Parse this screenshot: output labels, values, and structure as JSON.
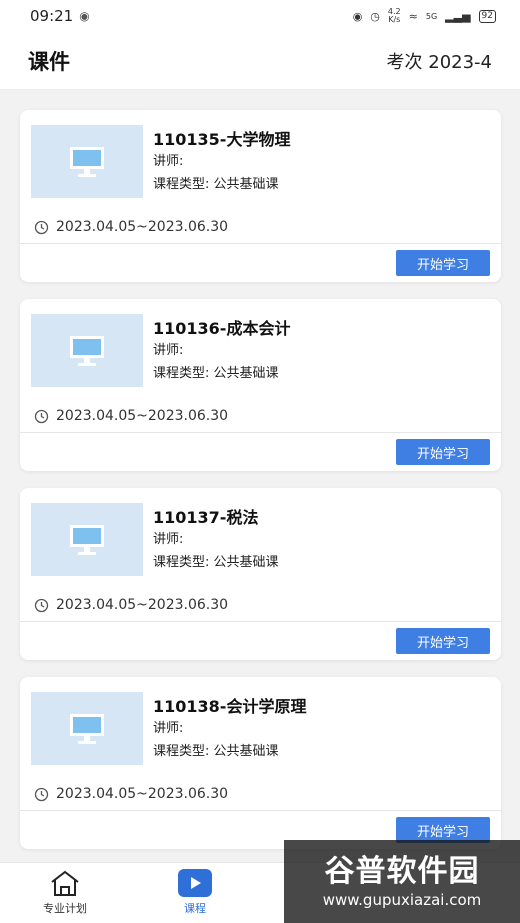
{
  "status_bar": {
    "time": "09:21",
    "speed_top": "4.2",
    "speed_bottom": "K/s",
    "network": "5G",
    "battery": "92"
  },
  "header": {
    "title": "课件",
    "exam_term": "考次 2023-4"
  },
  "courses": [
    {
      "title": "110135-大学物理",
      "teacher": "讲师:",
      "type": "课程类型:  公共基础课",
      "date_range": "2023.04.05~2023.06.30",
      "button": "开始学习"
    },
    {
      "title": "110136-成本会计",
      "teacher": "讲师:",
      "type": "课程类型:  公共基础课",
      "date_range": "2023.04.05~2023.06.30",
      "button": "开始学习"
    },
    {
      "title": "110137-税法",
      "teacher": "讲师:",
      "type": "课程类型:  公共基础课",
      "date_range": "2023.04.05~2023.06.30",
      "button": "开始学习"
    },
    {
      "title": "110138-会计学原理",
      "teacher": "讲师:",
      "type": "课程类型:  公共基础课",
      "date_range": "2023.04.05~2023.06.30",
      "button": "开始学习"
    }
  ],
  "tabbar": {
    "tabs": [
      {
        "label": "专业计划",
        "icon": "home-icon"
      },
      {
        "label": "课程",
        "icon": "play-icon",
        "active": true
      }
    ]
  },
  "watermark": {
    "brand": "谷普软件园",
    "url": "www.gupuxiazai.com"
  },
  "colors": {
    "accent": "#3f7ee3",
    "thumb_bg": "#d6e6f5",
    "active_tab": "#2e6fd8"
  }
}
